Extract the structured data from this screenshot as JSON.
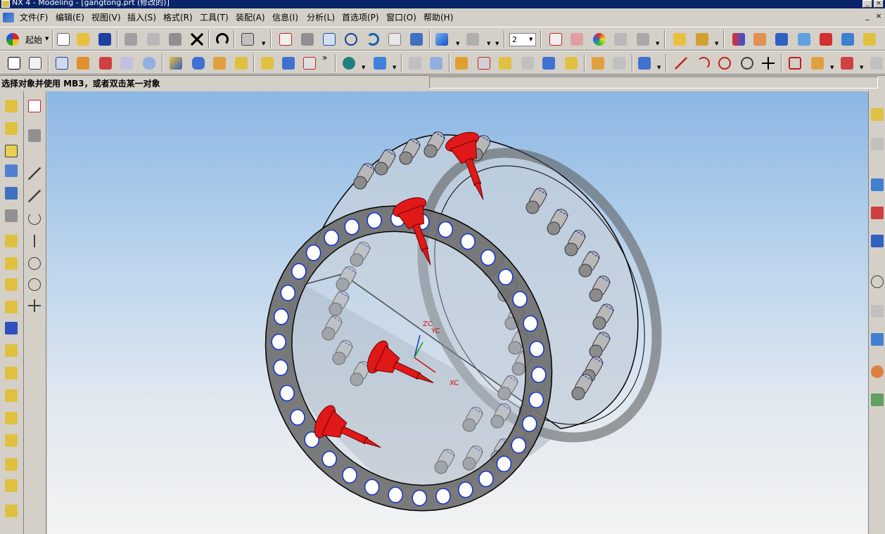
{
  "window": {
    "title": "NX 4 - Modeling - [gangtong.prt (修改的)]",
    "min_glyph": "_",
    "close_glyph": "×"
  },
  "menu": {
    "items": [
      "文件(F)",
      "编辑(E)",
      "视图(V)",
      "插入(S)",
      "格式(R)",
      "工具(T)",
      "装配(A)",
      "信息(I)",
      "分析(L)",
      "首选项(P)",
      "窗口(O)",
      "帮助(H)"
    ]
  },
  "toolbar": {
    "start_label": "起始",
    "layer_value": "2",
    "more_glyph": "»"
  },
  "status": {
    "prompt": "选择对象并使用 MB3，或者双击某一对象"
  },
  "viewport": {
    "axis_zc": "ZC",
    "axis_yc": "YC",
    "axis_xc": "XC"
  },
  "colors": {
    "ring_body": "#707070",
    "ring_glass": "#c8d4e0",
    "pin": "#b8b8b8",
    "hole_edge": "#1030d0",
    "nozzle": "#e01818",
    "axis_z": "#1428d8",
    "axis_y": "#10a010",
    "axis_x": "#d01010",
    "viewport_top": "#8bb7e3",
    "viewport_bottom": "#f3f3f3"
  }
}
